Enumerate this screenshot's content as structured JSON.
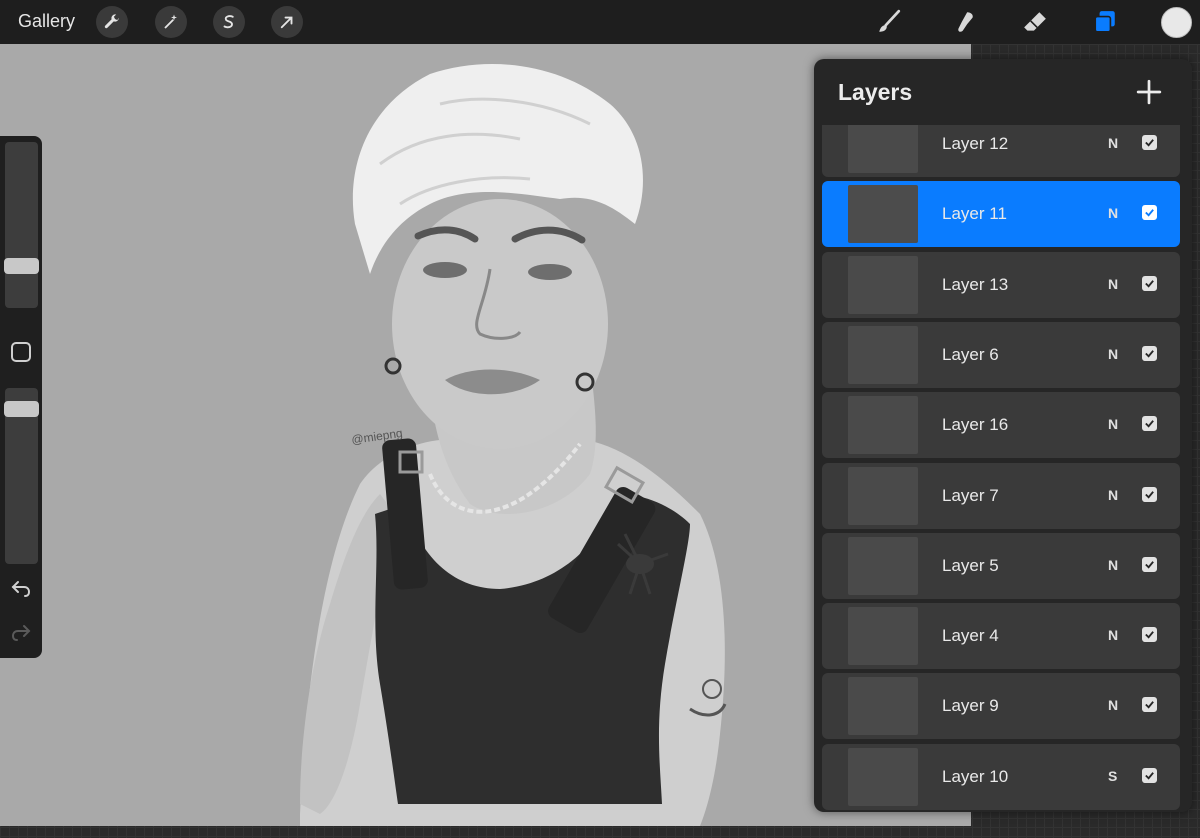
{
  "topbar": {
    "gallery_label": "Gallery",
    "left_tools": [
      "wrench-icon",
      "magic-wand-icon",
      "selection-icon",
      "transform-arrow-icon"
    ],
    "right_tools": [
      "brush-icon",
      "smudge-icon",
      "eraser-icon",
      "layers-icon"
    ],
    "current_color": "#e8e8e8",
    "active_tool": "layers",
    "accent": "#0a7cff"
  },
  "artwork": {
    "signature": "@miepng"
  },
  "layers": {
    "title": "Layers",
    "items": [
      {
        "name": "Layer 12",
        "mode": "N",
        "visible": true,
        "selected": false
      },
      {
        "name": "Layer 11",
        "mode": "N",
        "visible": true,
        "selected": true
      },
      {
        "name": "Layer 13",
        "mode": "N",
        "visible": true,
        "selected": false
      },
      {
        "name": "Layer 6",
        "mode": "N",
        "visible": true,
        "selected": false
      },
      {
        "name": "Layer 16",
        "mode": "N",
        "visible": true,
        "selected": false
      },
      {
        "name": "Layer 7",
        "mode": "N",
        "visible": true,
        "selected": false
      },
      {
        "name": "Layer 5",
        "mode": "N",
        "visible": true,
        "selected": false
      },
      {
        "name": "Layer 4",
        "mode": "N",
        "visible": true,
        "selected": false
      },
      {
        "name": "Layer 9",
        "mode": "N",
        "visible": true,
        "selected": false
      },
      {
        "name": "Layer 10",
        "mode": "S",
        "visible": true,
        "selected": false
      }
    ]
  },
  "sidebar": {
    "brush_size": 0.23,
    "opacity": 0.92
  }
}
